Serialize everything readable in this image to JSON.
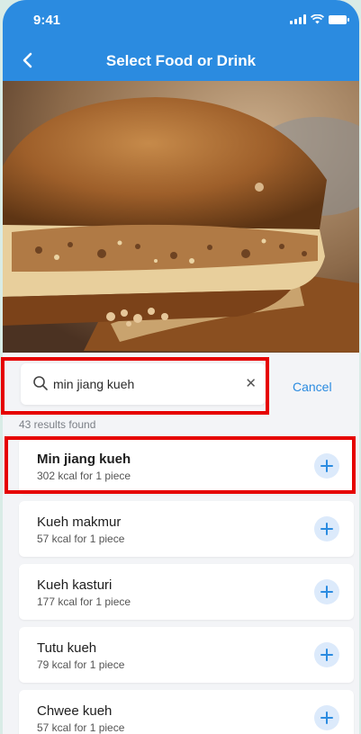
{
  "status_bar": {
    "time": "9:41"
  },
  "header": {
    "title": "Select Food or Drink"
  },
  "search": {
    "value": "min jiang kueh",
    "cancel_label": "Cancel"
  },
  "results": {
    "count_text": "43 results found",
    "items": [
      {
        "name": "Min jiang kueh",
        "kcal": "302 kcal for 1 piece"
      },
      {
        "name": "Kueh makmur",
        "kcal": "57 kcal for 1 piece"
      },
      {
        "name": "Kueh kasturi",
        "kcal": "177 kcal for 1 piece"
      },
      {
        "name": "Tutu kueh",
        "kcal": "79 kcal for 1 piece"
      },
      {
        "name": "Chwee kueh",
        "kcal": "57 kcal for 1 piece"
      }
    ]
  },
  "colors": {
    "header": "#2b8be0",
    "highlight": "#e60000",
    "add_button_bg": "#dceafb"
  }
}
